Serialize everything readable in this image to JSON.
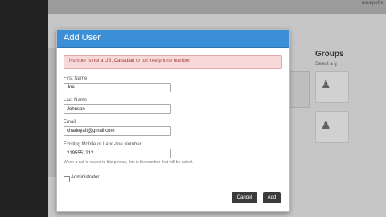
{
  "background": {
    "brand": "mastpohs",
    "groups_title": "Groups",
    "groups_sub": "Select a g"
  },
  "modal": {
    "title": "Add User",
    "alert": "Number is not a US, Canadian or toll free phone number",
    "fields": {
      "first_name": {
        "label": "First Name",
        "value": "Joe"
      },
      "last_name": {
        "label": "Last Name",
        "value": "Johnson"
      },
      "email": {
        "label": "Email",
        "value": "chadeyaft@gmail.com"
      },
      "phone": {
        "label": "Existing Mobile or Land-line Number",
        "value": "2195551212",
        "hint": "When a call is routed to this person, this is the number that will be called."
      }
    },
    "administrator_label": "Administrator",
    "cancel_label": "Cancel",
    "add_label": "Add"
  },
  "colors": {
    "header": "#3a8fd6",
    "alert_bg": "#f7d9d9",
    "button": "#3b3b3b"
  }
}
